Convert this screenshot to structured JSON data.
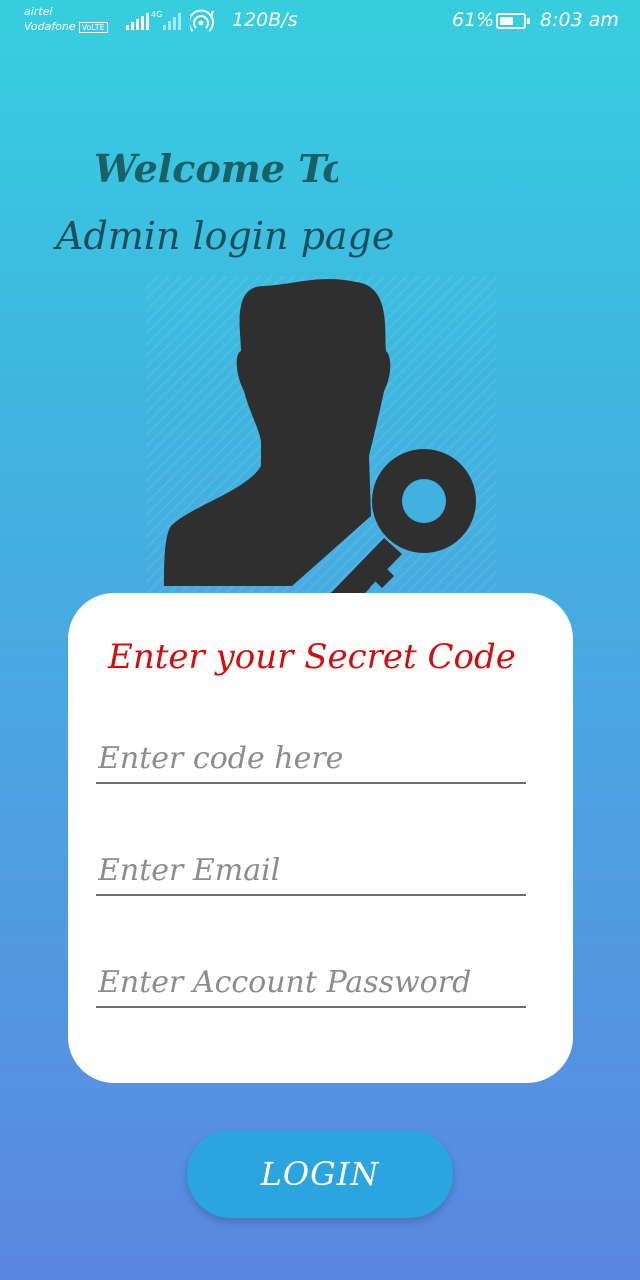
{
  "status_bar": {
    "carrier_1": "airtel",
    "carrier_2": "Vodafone",
    "volte_badge": "VoLTE",
    "network_type": "4G",
    "data_speed": "120B/s",
    "battery_percent": "61%",
    "battery_level": 0.61,
    "time": "8:03 am"
  },
  "header": {
    "welcome": "Welcome To",
    "subtitle": "Admin login page"
  },
  "illustration": {
    "icon": "admin-key-icon",
    "color": "#2f2f2f"
  },
  "form": {
    "title": "Enter your Secret Code",
    "code_placeholder": "Enter code here",
    "email_placeholder": "Enter Email",
    "password_placeholder": "Enter Account Password"
  },
  "login_button": {
    "label": "LOGIN"
  },
  "colors": {
    "gradient_top": "#36cfdf",
    "gradient_bottom": "#5a87e0",
    "title_red": "#d10e0e",
    "button_blue": "#2aa5df",
    "heading_teal": "#1b5f67"
  }
}
